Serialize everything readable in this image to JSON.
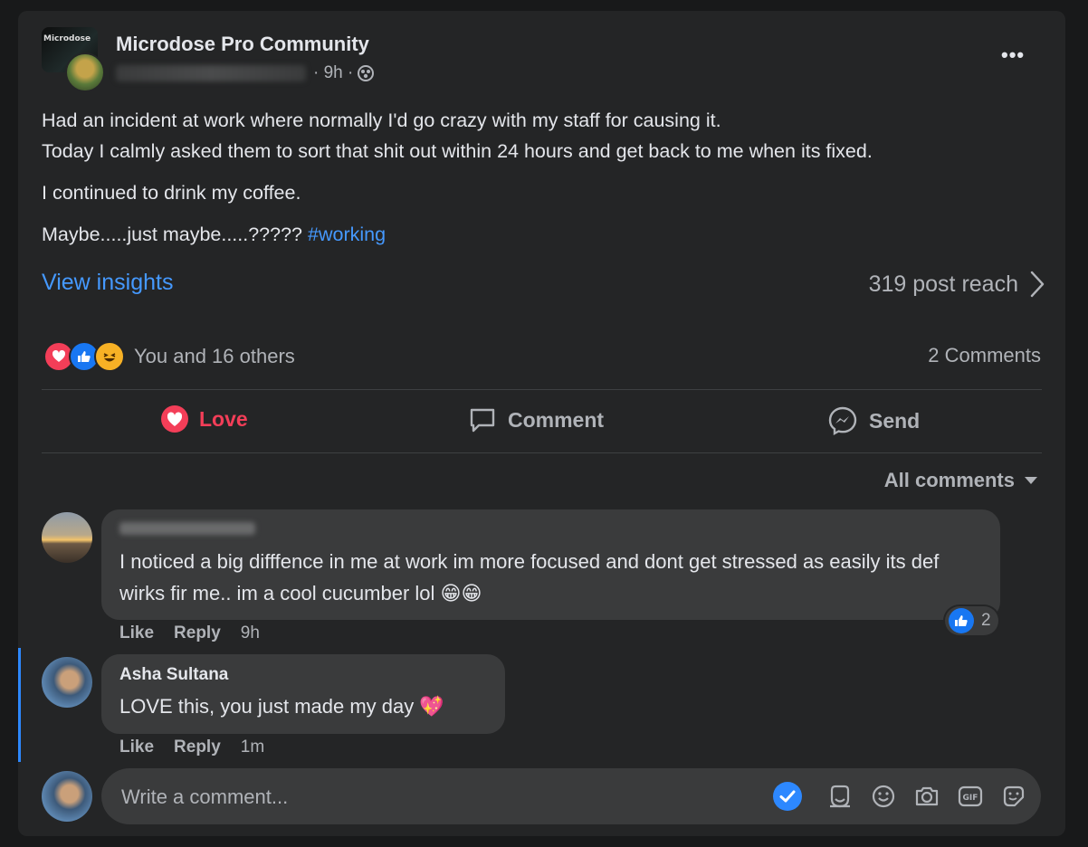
{
  "post": {
    "group_name": "Microdose Pro Community",
    "group_avatar_text": "Microdose",
    "time": "· 9h ·",
    "more_label": "•••",
    "paragraphs": [
      "Had an incident at work where normally I'd go crazy with my staff for causing it.",
      " Today I calmly asked them to sort that shit out within 24 hours and get back to me when its fixed.",
      "I continued to drink my coffee.",
      "Maybe.....just maybe.....?????"
    ],
    "hashtag": "#working",
    "insights_label": "View insights",
    "reach": "319 post reach",
    "reactions_text": "You and 16 others",
    "comments_count": "2 Comments"
  },
  "actions": {
    "love": "Love",
    "comment": "Comment",
    "send": "Send"
  },
  "comments_filter": "All comments",
  "comments": [
    {
      "author": "",
      "text": "I noticed a big difffence in me at work im more focused and dont get stressed as easily its def wirks fir me.. im a cool cucumber lol 😁😁",
      "like": "Like",
      "reply": "Reply",
      "time": "9h",
      "reaction_count": "2"
    },
    {
      "author": "Asha Sultana",
      "text": "LOVE this, you just made my day 💖",
      "like": "Like",
      "reply": "Reply",
      "time": "1m"
    }
  ],
  "composer": {
    "placeholder": "Write a comment..."
  },
  "colors": {
    "background": "#18191a",
    "card": "#242526",
    "bubble": "#3a3b3c",
    "link": "#4599ff",
    "love": "#f33e58",
    "like": "#1877f2",
    "text_secondary": "#b0b3b8"
  },
  "icons": [
    "globe-icon",
    "more-icon",
    "chevron-right-icon",
    "love-reaction-icon",
    "like-reaction-icon",
    "haha-reaction-icon",
    "heart-icon",
    "comment-icon",
    "messenger-icon",
    "caret-down-icon",
    "checkmark-icon",
    "avatar-sticker-icon",
    "emoji-icon",
    "camera-icon",
    "gif-icon",
    "sticker-icon"
  ]
}
